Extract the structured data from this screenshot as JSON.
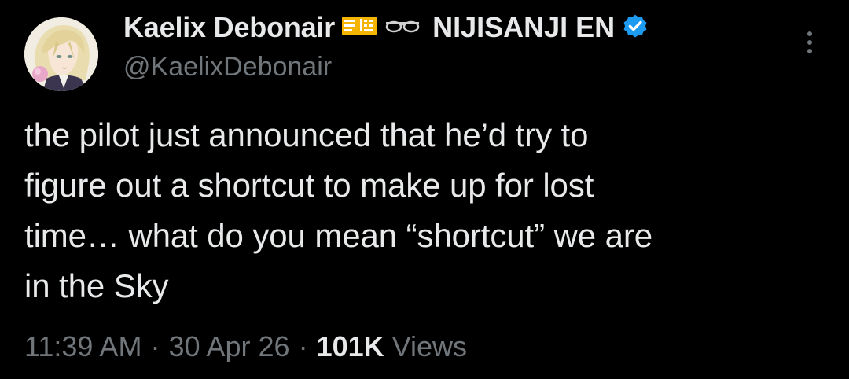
{
  "author": {
    "display_name": "Kaelix Debonair",
    "name_suffix": "NIJISANJI EN",
    "handle": "@KaelixDebonair",
    "verified": true,
    "emojis": [
      "ticket-emoji",
      "glasses-emoji"
    ],
    "verified_color": "#1d9bf0"
  },
  "tweet": {
    "text": "the pilot just announced that he’d try to\nfigure out a shortcut to make up for lost\ntime… what do you mean “shortcut” we are\nin the Sky"
  },
  "meta": {
    "time": "11:39 AM",
    "date": "30 Apr 26",
    "separator": "·",
    "views_count": "101K",
    "views_label": "Views"
  },
  "menu": {
    "icon": "more-vertical-icon"
  },
  "colors": {
    "background": "#000000",
    "primary_text": "#e7e9ea",
    "secondary_text": "#71767b",
    "accent": "#1d9bf0"
  }
}
